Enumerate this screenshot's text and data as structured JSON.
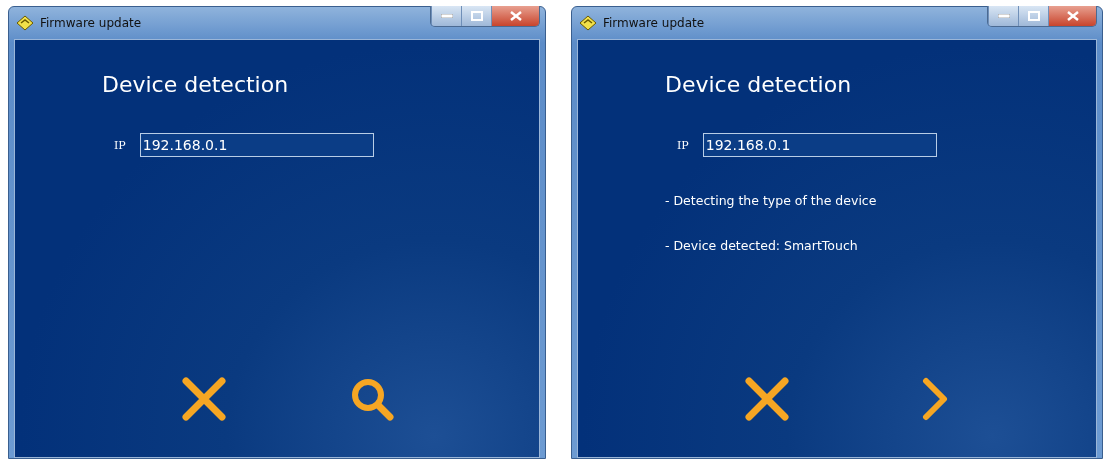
{
  "windows": [
    {
      "title": "Firmware update",
      "heading": "Device detection",
      "ip_label": "IP",
      "ip_value": "192.168.0.1",
      "buttons": [
        {
          "kind": "cancel"
        },
        {
          "kind": "search"
        }
      ]
    },
    {
      "title": "Firmware update",
      "heading": "Device detection",
      "ip_label": "IP",
      "ip_value": "192.168.0.1",
      "messages": [
        "- Detecting the type of the device",
        "- Device detected: SmartTouch"
      ],
      "buttons": [
        {
          "kind": "cancel"
        },
        {
          "kind": "next"
        }
      ]
    }
  ]
}
